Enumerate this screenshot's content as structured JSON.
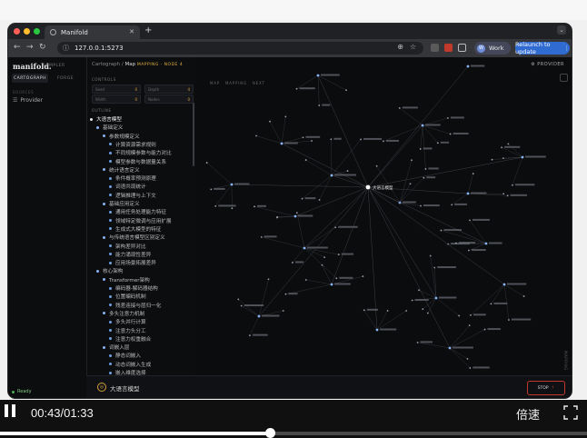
{
  "browser": {
    "tab_title": "Manifold",
    "url": "127.0.0.1:5273",
    "profile_label": "Work",
    "relaunch_label": "Relaunch to update"
  },
  "app": {
    "brand": "manifold.",
    "brand_sub": "SAMPLER",
    "mode_active": "CARTOGRAPH",
    "mode_other": "FORGE",
    "sidebar_section": "SOURCES",
    "sidebar_item": "Provider",
    "status_text": "Ready",
    "breadcrumb_root": "Cartograph",
    "breadcrumb_current": "Map",
    "breadcrumb_status": "MAPPING · NODE 4",
    "controls_label": "CONTROLS",
    "tree_label": "OUTLINE",
    "provider_button": "PROVIDER",
    "map_tabs": [
      "MAP",
      "MAPPING",
      "NEXT"
    ],
    "right_vertical_label": "MAPPING"
  },
  "controls": [
    {
      "label": "Seed",
      "value": "0"
    },
    {
      "label": "Depth",
      "value": "4"
    },
    {
      "label": "Width",
      "value": "0"
    },
    {
      "label": "Nodes",
      "value": "0"
    }
  ],
  "tree": [
    {
      "level": 0,
      "label": "大语言模型"
    },
    {
      "level": 1,
      "label": "基础定义"
    },
    {
      "level": 2,
      "label": "参数规模定义"
    },
    {
      "level": 3,
      "label": "计算资源需求规则"
    },
    {
      "level": 3,
      "label": "不同规模参数与能力对比"
    },
    {
      "level": 3,
      "label": "模型参数与数据量关系"
    },
    {
      "level": 2,
      "label": "统计语言定义"
    },
    {
      "level": 3,
      "label": "条件概率预测原理"
    },
    {
      "level": 3,
      "label": "词语共现统计"
    },
    {
      "level": 3,
      "label": "逻辑推理与上下文"
    },
    {
      "level": 2,
      "label": "基础应用定义"
    },
    {
      "level": 3,
      "label": "通用任务处理能力特征"
    },
    {
      "level": 3,
      "label": "领域特定微调与应用扩展"
    },
    {
      "level": 3,
      "label": "生成式大模型的特征"
    },
    {
      "level": 2,
      "label": "与传统语言模型区别定义"
    },
    {
      "level": 3,
      "label": "架构差异对比"
    },
    {
      "level": 3,
      "label": "能力涌现性差异"
    },
    {
      "level": 3,
      "label": "应用场景拓展差异"
    },
    {
      "level": 1,
      "label": "核心架构"
    },
    {
      "level": 2,
      "label": "Transformer架构"
    },
    {
      "level": 3,
      "label": "编码器-解码器结构"
    },
    {
      "level": 3,
      "label": "位置编码机制"
    },
    {
      "level": 3,
      "label": "残差连接与层归一化"
    },
    {
      "level": 2,
      "label": "多头注意力机制"
    },
    {
      "level": 3,
      "label": "多头并行计算"
    },
    {
      "level": 3,
      "label": "注意力头分工"
    },
    {
      "level": 3,
      "label": "注意力权重融合"
    },
    {
      "level": 2,
      "label": "词嵌入层"
    },
    {
      "level": 3,
      "label": "静态词嵌入"
    },
    {
      "level": 3,
      "label": "动态词嵌入生成"
    },
    {
      "level": 3,
      "label": "嵌入维度选择"
    }
  ],
  "graph": {
    "center_label": "大语言模型",
    "labels": [
      "核心架构",
      "训练方法",
      "应用场景",
      "评估体系",
      "基础定义",
      "发展趋势"
    ]
  },
  "query": {
    "text": "大语言模型",
    "stop_label": "STOP"
  },
  "player": {
    "time": "00:43/01:33",
    "speed_label": "倍速",
    "progress": 0.46
  },
  "colors": {
    "accent": "#d6a23a",
    "node": "#8ab4f8",
    "stop": "#c0392b"
  }
}
